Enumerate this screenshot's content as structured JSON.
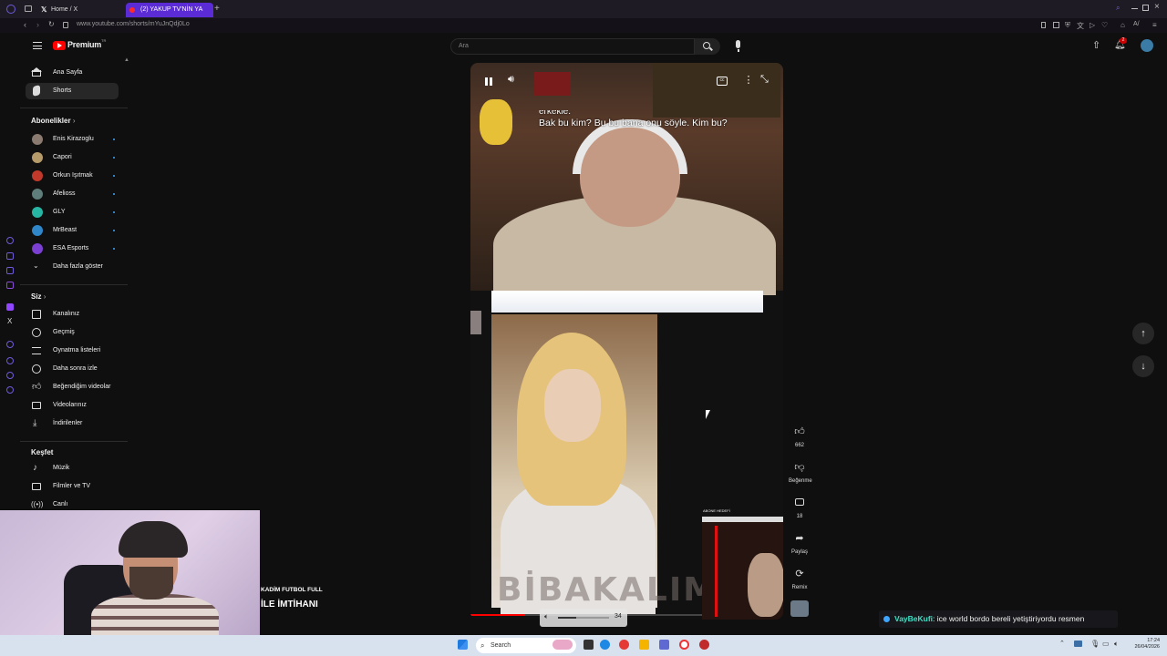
{
  "browser": {
    "tabs": [
      {
        "label": "Home / X"
      },
      {
        "label": "(2) YAKUP TV'NİN YA"
      }
    ],
    "url": "www.youtube.com/shorts/mYuJnQdj0Lo"
  },
  "youtube": {
    "logo_text": "Premium",
    "logo_region": "TR",
    "search_placeholder": "Ara",
    "notification_count": "2"
  },
  "sidebar": {
    "main": [
      {
        "label": "Ana Sayfa",
        "icon": "home-icon"
      },
      {
        "label": "Shorts",
        "icon": "shorts-icon",
        "active": true
      }
    ],
    "subscriptions_title": "Abonelikler",
    "subscriptions": [
      {
        "label": "Enis Kirazoglu",
        "color": "#8a7a70"
      },
      {
        "label": "Capori",
        "color": "#b59a6a"
      },
      {
        "label": "Orkun Işıtmak",
        "color": "#c0392b"
      },
      {
        "label": "Afelioss",
        "color": "#5f7d7a"
      },
      {
        "label": "GLY",
        "color": "#27b5a4"
      },
      {
        "label": "MrBeast",
        "color": "#2f86c9"
      },
      {
        "label": "ESA Esports",
        "color": "#7b3fd1"
      }
    ],
    "show_more": "Daha fazla göster",
    "you_title": "Siz",
    "you": [
      {
        "label": "Kanalınız",
        "icon": "channel-icon"
      },
      {
        "label": "Geçmiş",
        "icon": "history-icon"
      },
      {
        "label": "Oynatma listeleri",
        "icon": "playlist-icon"
      },
      {
        "label": "Daha sonra izle",
        "icon": "clock-icon"
      },
      {
        "label": "Beğendiğim videolar",
        "icon": "like-icon"
      },
      {
        "label": "Videolarınız",
        "icon": "video-icon"
      },
      {
        "label": "İndirilenler",
        "icon": "download-icon"
      }
    ],
    "explore_title": "Keşfet",
    "explore": [
      {
        "label": "Müzik",
        "icon": "music-icon"
      },
      {
        "label": "Filmler ve TV",
        "icon": "film-icon"
      },
      {
        "label": "Canlı",
        "icon": "live-icon"
      }
    ]
  },
  "video": {
    "subtitle_cut": "erkekle.",
    "subtitle_main": "Bak bu kim? Bu bu bana onu söyle. Kim bu?",
    "watermark": "BİBAKALIM",
    "mini_label": "ABONE HEDEFİ",
    "volume": "34"
  },
  "actions": {
    "like_count": "662",
    "dislike_label": "Beğenme",
    "comment_count": "18",
    "share_label": "Paylaş",
    "remix_label": "Remix"
  },
  "stream_overlay": {
    "line1": "KADİM FUTBOL FULL",
    "line2": "İLE İMTİHANI"
  },
  "chat": {
    "user": "VayBeKufi",
    "message": ": ice world bordo bereli yetiştiriyordu resmen",
    "user_color": "#3de0c4"
  },
  "taskbar": {
    "search_label": "Search",
    "time": "17:24",
    "date": "26/04/2026"
  }
}
